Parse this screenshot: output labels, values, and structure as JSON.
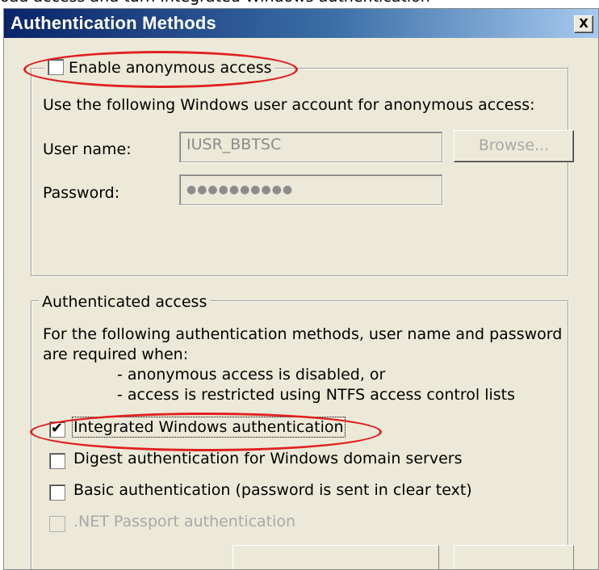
{
  "top_text": "oad access and turn Integrated Windows authentication",
  "dialog": {
    "title": "Authentication Methods",
    "close_label": "X"
  },
  "anonymous": {
    "checkbox_label": "Enable anonymous access",
    "checked": false,
    "description": "Use the following Windows user account for anonymous access:",
    "username_label": "User name:",
    "username_value": "IUSR_BBTSC",
    "browse_label": "Browse...",
    "password_label": "Password:",
    "password_value": "●●●●●●●●●●"
  },
  "authenticated": {
    "legend": "Authenticated access",
    "description_line1": "For the following authentication methods, user name and password",
    "description_line2": "are required when:",
    "bullet1": "- anonymous access is disabled, or",
    "bullet2": "- access is restricted using NTFS access control lists",
    "methods": [
      {
        "label": "Integrated Windows authentication",
        "checked": true,
        "enabled": true
      },
      {
        "label": "Digest authentication for Windows domain servers",
        "checked": false,
        "enabled": true
      },
      {
        "label": "Basic authentication (password is sent in clear text)",
        "checked": false,
        "enabled": true
      },
      {
        "label": ".NET Passport authentication",
        "checked": false,
        "enabled": false
      }
    ]
  },
  "colors": {
    "dialog_bg": "#ece9d8",
    "titlebar_start": "#0a246a",
    "titlebar_end": "#a6caf0",
    "highlight_red": "#e02020"
  }
}
